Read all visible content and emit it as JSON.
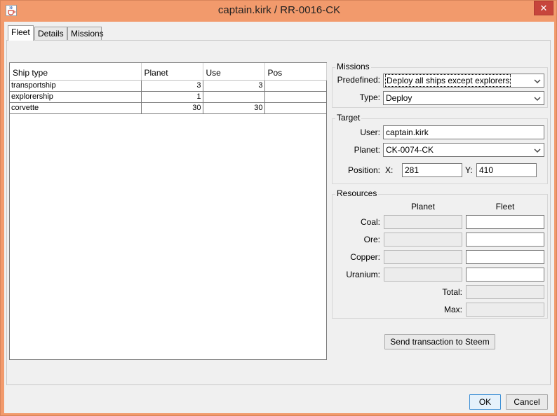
{
  "window": {
    "title": "captain.kirk / RR-0016-CK"
  },
  "tabs": [
    {
      "label": "Fleet",
      "active": true
    },
    {
      "label": "Details",
      "active": false
    },
    {
      "label": "Missions",
      "active": false
    }
  ],
  "ships_table": {
    "headers": [
      "Ship type",
      "Planet",
      "Use",
      "Pos"
    ],
    "rows": [
      {
        "ship_type": "transportship",
        "planet": "3",
        "use": "3",
        "pos": ""
      },
      {
        "ship_type": "explorership",
        "planet": "1",
        "use": "",
        "pos": ""
      },
      {
        "ship_type": "corvette",
        "planet": "30",
        "use": "30",
        "pos": ""
      }
    ]
  },
  "missions": {
    "title": "Missions",
    "predefined_label": "Predefined:",
    "predefined_value": "Deploy all ships except explorers",
    "type_label": "Type:",
    "type_value": "Deploy"
  },
  "target": {
    "title": "Target",
    "user_label": "User:",
    "user_value": "captain.kirk",
    "planet_label": "Planet:",
    "planet_value": "CK-0074-CK",
    "position_label": "Position:",
    "x_label": "X:",
    "x_value": "281",
    "y_label": "Y:",
    "y_value": "410"
  },
  "resources": {
    "title": "Resources",
    "planet_header": "Planet",
    "fleet_header": "Fleet",
    "coal_label": "Coal:",
    "ore_label": "Ore:",
    "copper_label": "Copper:",
    "uranium_label": "Uranium:",
    "total_label": "Total:",
    "max_label": "Max:"
  },
  "actions": {
    "send_label": "Send transaction to Steem",
    "ok_label": "OK",
    "cancel_label": "Cancel"
  },
  "colors": {
    "titlebar": "#f29a6c",
    "close_button": "#c7453c",
    "panel": "#f0f0f0"
  }
}
